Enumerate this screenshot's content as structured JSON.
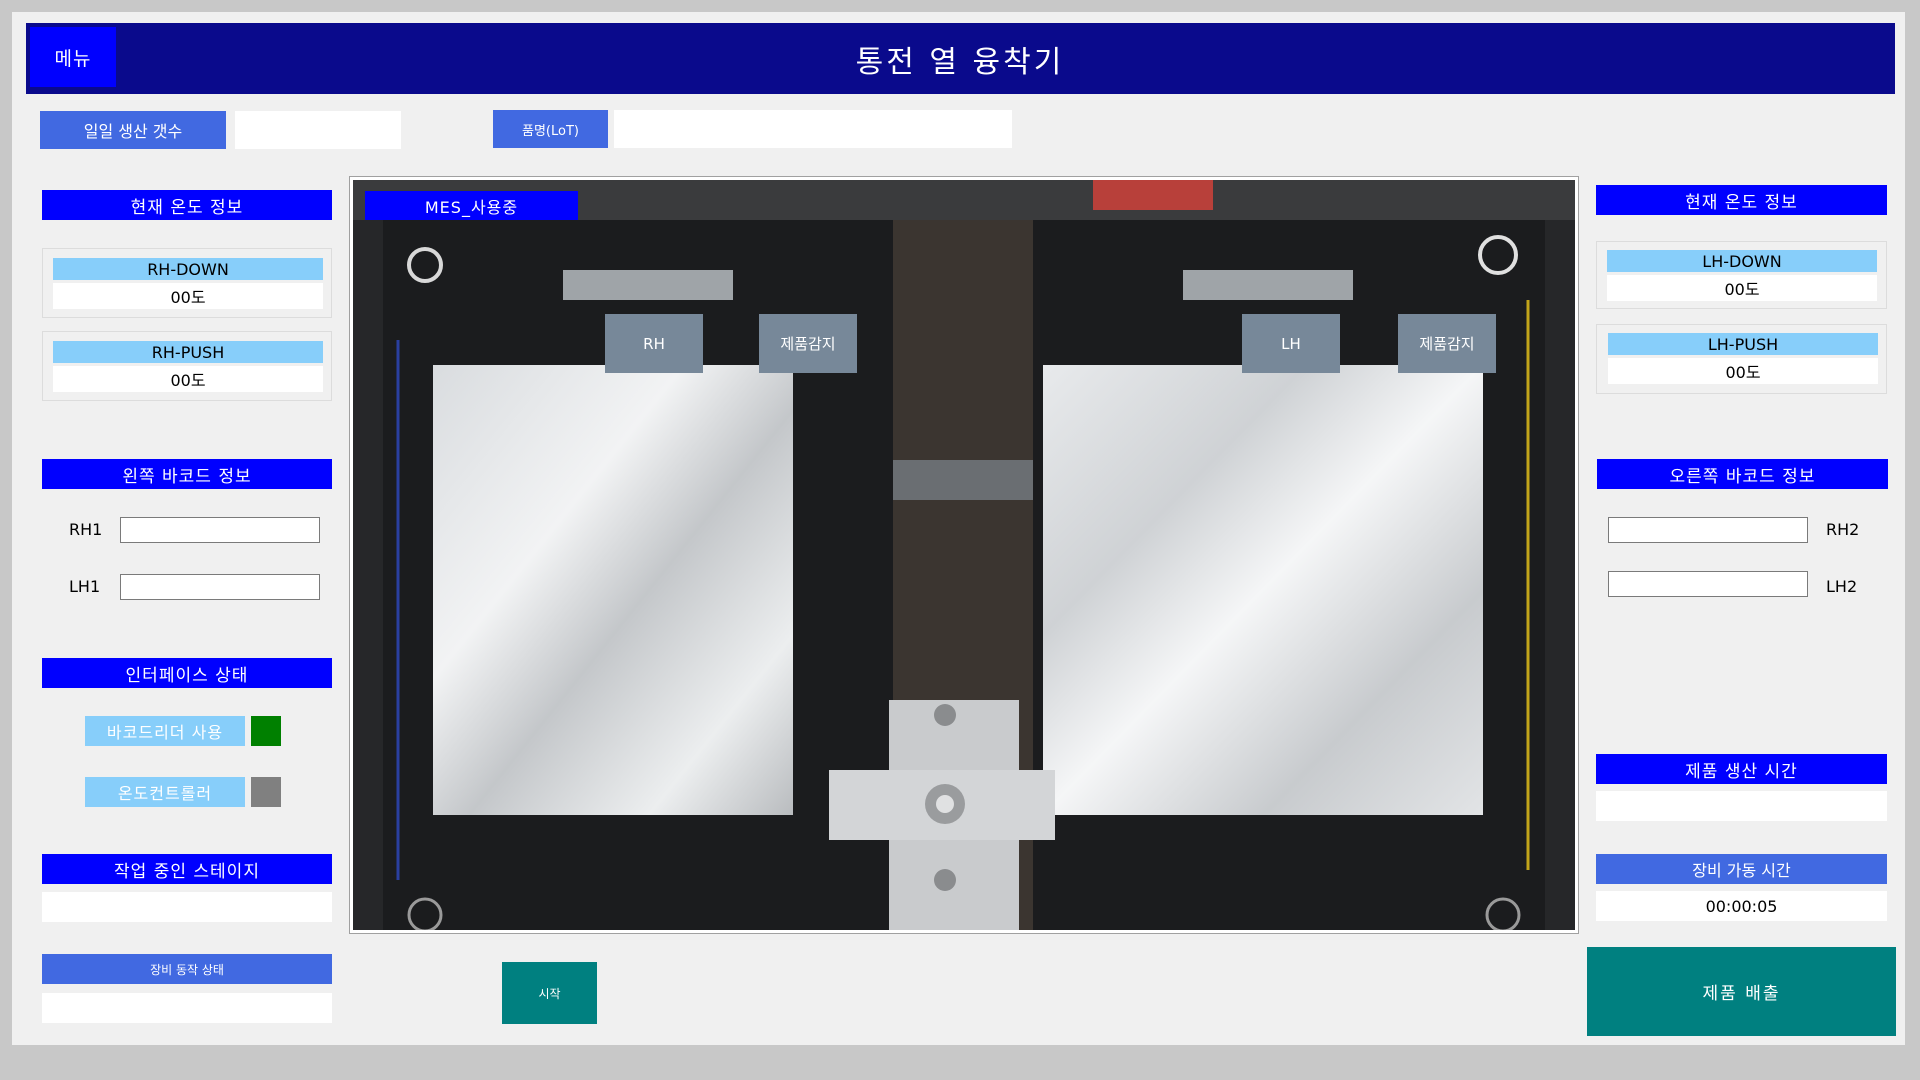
{
  "header": {
    "menu_label": "메뉴",
    "title": "통전 열 융착기"
  },
  "top": {
    "daily_count_label": "일일 생산 갯수",
    "daily_count_value": "",
    "product_label": "품명(LoT)",
    "product_value": ""
  },
  "left": {
    "temp_title": "현재 온도 정보",
    "rh_down_label": "RH-DOWN",
    "rh_down_value": "00도",
    "rh_push_label": "RH-PUSH",
    "rh_push_value": "00도",
    "barcode_title": "왼쪽 바코드 정보",
    "rh1_label": "RH1",
    "lh1_label": "LH1",
    "interface_title": "인터페이스 상태",
    "barcode_reader_label": "바코드리더 사용",
    "temp_controller_label": "온도컨트롤러",
    "stage_title": "작업 중인 스테이지",
    "stage_value": "",
    "equip_status_title": "장비 동작 상태",
    "equip_status_value": ""
  },
  "camera": {
    "mes_label": "MES_사용중",
    "rh_label": "RH",
    "rh_sensor_label": "제품감지",
    "lh_label": "LH",
    "lh_sensor_label": "제품감지"
  },
  "right": {
    "temp_title": "현재 온도 정보",
    "lh_down_label": "LH-DOWN",
    "lh_down_value": "00도",
    "lh_push_label": "LH-PUSH",
    "lh_push_value": "00도",
    "barcode_title": "오른쪽 바코드 정보",
    "rh2_label": "RH2",
    "lh2_label": "LH2",
    "prod_time_title": "제품 생산 시간",
    "prod_time_value": "",
    "uptime_title": "장비 가동 시간",
    "uptime_value": "00:00:05"
  },
  "buttons": {
    "start_label": "시작",
    "eject_label": "제품 배출"
  },
  "colors": {
    "header_bg": "#0a0a8c",
    "section_blue": "#0000ff",
    "royal_blue": "#4169e1",
    "light_blue": "#87cefa",
    "teal": "#008080",
    "indicator_barcode_reader": "#008000",
    "indicator_temp_controller": "#808080",
    "slate": "#778899"
  }
}
